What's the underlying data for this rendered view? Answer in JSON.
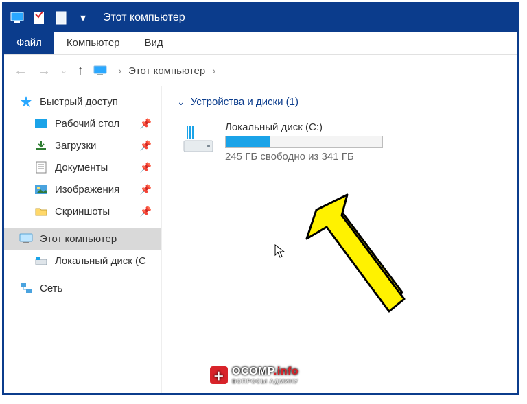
{
  "title": "Этот компьютер",
  "ribbon": {
    "file": "Файл",
    "computer": "Компьютер",
    "view": "Вид"
  },
  "breadcrumb": {
    "root": "Этот компьютер"
  },
  "sidebar": {
    "quick_access": "Быстрый доступ",
    "items": [
      {
        "label": "Рабочий стол"
      },
      {
        "label": "Загрузки"
      },
      {
        "label": "Документы"
      },
      {
        "label": "Изображения"
      },
      {
        "label": "Скриншоты"
      }
    ],
    "this_pc": "Этот компьютер",
    "local_disk": "Локальный диск (C",
    "network": "Сеть"
  },
  "section": {
    "header": "Устройства и диски (1)"
  },
  "drive": {
    "name": "Локальный диск (C:)",
    "space": "245 ГБ свободно из 341 ГБ",
    "fill_percent": 28
  },
  "watermark": {
    "brand": "OCOMP",
    "tld": ".info",
    "sub": "ВОПРОСЫ АДМИНУ"
  }
}
